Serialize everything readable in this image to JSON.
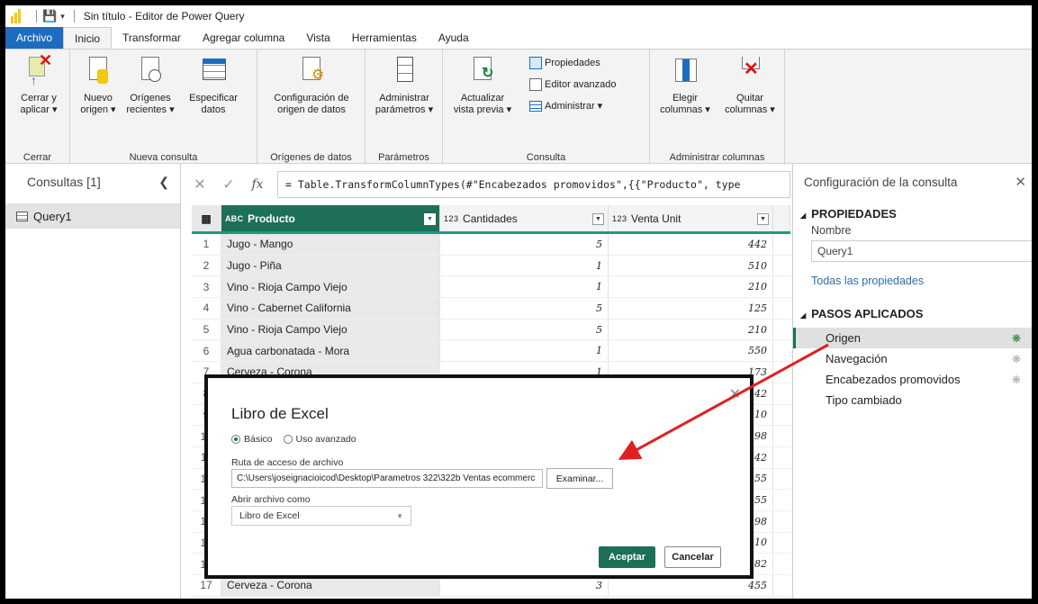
{
  "window": {
    "title": "Sin título - Editor de Power Query"
  },
  "tabs": [
    "Archivo",
    "Inicio",
    "Transformar",
    "Agregar columna",
    "Vista",
    "Herramientas",
    "Ayuda"
  ],
  "ribbon": {
    "cerrar_label": "Cerrar y\naplicar ▾",
    "nuevo_origen": "Nuevo\norigen ▾",
    "origenes_recientes": "Orígenes\nrecientes ▾",
    "especificar_datos": "Especificar\ndatos",
    "config_origen": "Configuración de\norigen de datos",
    "administrar_parametros": "Administrar\nparámetros ▾",
    "actualizar": "Actualizar\nvista previa ▾",
    "propiedades": "Propiedades",
    "editor_avanzado": "Editor avanzado",
    "administrar": "Administrar ▾",
    "elegir_columnas": "Elegir\ncolumnas ▾",
    "quitar_columnas": "Quitar\ncolumnas ▾",
    "groups": {
      "cerrar": "Cerrar",
      "nueva_consulta": "Nueva consulta",
      "origenes": "Orígenes de datos",
      "parametros": "Parámetros",
      "consulta": "Consulta",
      "administrar_columnas": "Administrar columnas"
    }
  },
  "left_pane": {
    "header": "Consultas [1]",
    "query": "Query1"
  },
  "formula": "= Table.TransformColumnTypes(#\"Encabezados promovidos\",{{\"Producto\", type",
  "grid": {
    "headers": {
      "producto_type": "A B C",
      "producto": "Producto",
      "cantidades_type": "1 2 3",
      "cantidades": "Cantidades",
      "venta_type": "1 2 3",
      "venta": "Venta Unit"
    },
    "rows": [
      {
        "n": "1",
        "producto": "Jugo - Mango",
        "cant": "5",
        "venta": "442"
      },
      {
        "n": "2",
        "producto": "Jugo - Piña",
        "cant": "1",
        "venta": "510"
      },
      {
        "n": "3",
        "producto": "Vino - Rioja Campo Viejo",
        "cant": "1",
        "venta": "210"
      },
      {
        "n": "4",
        "producto": "Vino - Cabernet California",
        "cant": "5",
        "venta": "125"
      },
      {
        "n": "5",
        "producto": "Vino - Rioja Campo Viejo",
        "cant": "5",
        "venta": "210"
      },
      {
        "n": "6",
        "producto": "Agua carbonatada - Mora",
        "cant": "1",
        "venta": "550"
      },
      {
        "n": "7",
        "producto": "Cerveza - Corona",
        "cant": "1",
        "venta": "173"
      },
      {
        "n": "8",
        "producto": "",
        "cant": "",
        "venta": "442"
      },
      {
        "n": "9",
        "producto": "",
        "cant": "",
        "venta": "510"
      },
      {
        "n": "10",
        "producto": "",
        "cant": "",
        "venta": "198"
      },
      {
        "n": "11",
        "producto": "",
        "cant": "",
        "venta": "442"
      },
      {
        "n": "12",
        "producto": "",
        "cant": "",
        "venta": "455"
      },
      {
        "n": "13",
        "producto": "",
        "cant": "",
        "venta": "455"
      },
      {
        "n": "14",
        "producto": "",
        "cant": "",
        "venta": "198"
      },
      {
        "n": "15",
        "producto": "",
        "cant": "",
        "venta": "210"
      },
      {
        "n": "16",
        "producto": "",
        "cant": "",
        "venta": "182"
      },
      {
        "n": "17",
        "producto": "Cerveza - Corona",
        "cant": "3",
        "venta": "455"
      }
    ]
  },
  "right_pane": {
    "header": "Configuración de la consulta",
    "propiedades": "PROPIEDADES",
    "nombre_label": "Nombre",
    "nombre_value": "Query1",
    "todas_propiedades": "Todas las propiedades",
    "pasos": "PASOS APLICADOS",
    "steps": [
      "Origen",
      "Navegación",
      "Encabezados promovidos",
      "Tipo cambiado"
    ]
  },
  "dialog": {
    "title": "Libro de Excel",
    "basico": "Básico",
    "avanzado": "Uso avanzado",
    "ruta_label": "Ruta de acceso de archivo",
    "ruta_value": "C:\\Users\\joseignacioicod\\Desktop\\Parametros 322\\322b Ventas ecommerc",
    "examinar": "Examinar...",
    "abrir_label": "Abrir archivo como",
    "abrir_value": "Libro de Excel",
    "aceptar": "Aceptar",
    "cancelar": "Cancelar"
  },
  "colors": {
    "accent": "#1e6f57",
    "file_tab": "#1e6cbf",
    "arrow": "#e02020"
  }
}
